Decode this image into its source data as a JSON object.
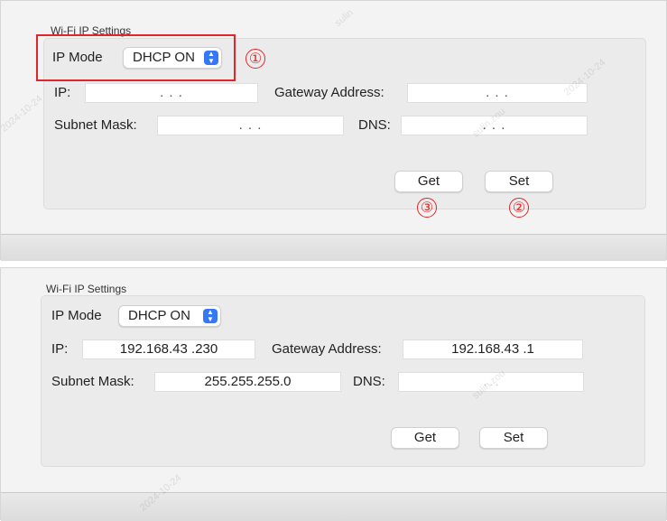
{
  "top": {
    "group_title": "Wi-Fi IP Settings",
    "ip_mode_label": "IP Mode",
    "ip_mode_value": "DHCP ON",
    "ip_label": "IP:",
    "ip_value": ". . .",
    "gateway_label": "Gateway Address:",
    "gateway_value": ". . .",
    "subnet_label": "Subnet Mask:",
    "subnet_value": ". . .",
    "dns_label": "DNS:",
    "dns_value": ". . .",
    "get_label": "Get",
    "set_label": "Set",
    "markers": [
      "①",
      "②",
      "③"
    ]
  },
  "bottom": {
    "group_title": "Wi-Fi IP Settings",
    "ip_mode_label": "IP Mode",
    "ip_mode_value": "DHCP ON",
    "ip_label": "IP:",
    "ip_value": "192.168.43 .230",
    "gateway_label": "Gateway Address:",
    "gateway_value": "192.168.43 .1",
    "subnet_label": "Subnet Mask:",
    "subnet_value": "255.255.255.0",
    "dns_label": "DNS:",
    "dns_value": ". . .",
    "get_label": "Get",
    "set_label": "Set"
  },
  "watermark": [
    "sulin",
    "2024-10-24",
    "sulin.zou",
    "2024-10-24",
    "sulin.zou",
    "2024-10-24"
  ],
  "colors": {
    "annotation_red": "#e0262b",
    "select_accent": "#3478f6"
  },
  "icons": {
    "select_arrow": "updown-chevron-icon"
  }
}
